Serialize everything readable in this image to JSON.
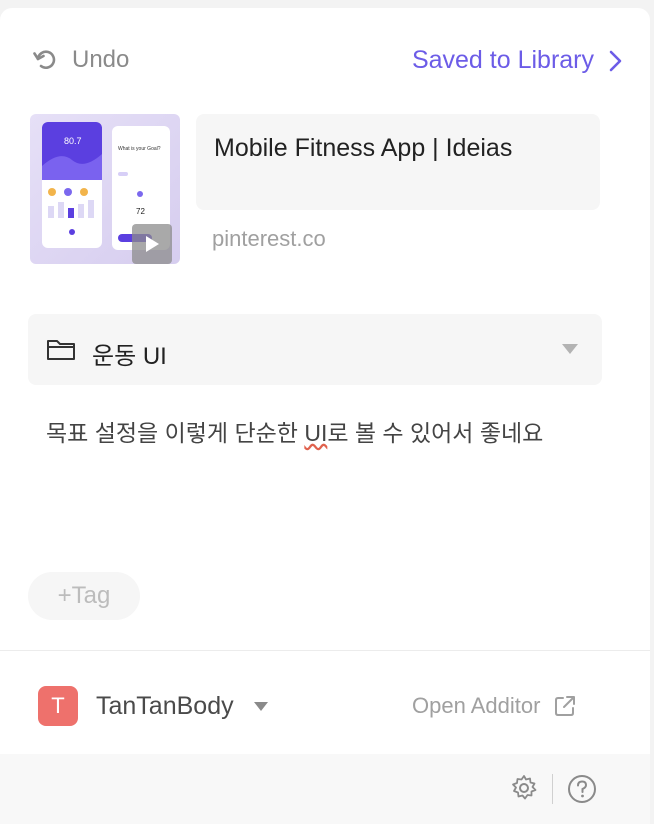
{
  "header": {
    "undo_label": "Undo",
    "saved_label": "Saved to Library"
  },
  "pin": {
    "title": "Mobile Fitness App | Ideias",
    "source": "pinterest.co"
  },
  "folder": {
    "name": "운동 UI"
  },
  "note": {
    "before": "목표 설정을 이렇게 단순한 ",
    "flagged": "UI",
    "after": "로 볼 수 있어서 좋네요"
  },
  "tag": {
    "label": "+Tag"
  },
  "account": {
    "initial": "T",
    "name": "TanTanBody"
  },
  "open_additor": {
    "label": "Open Additor"
  },
  "thumbnail": {
    "phone_value": "80.7",
    "question": "What is your Goal?",
    "number": "72"
  },
  "colors": {
    "accent": "#6c5ce7",
    "avatar": "#ee716c"
  }
}
